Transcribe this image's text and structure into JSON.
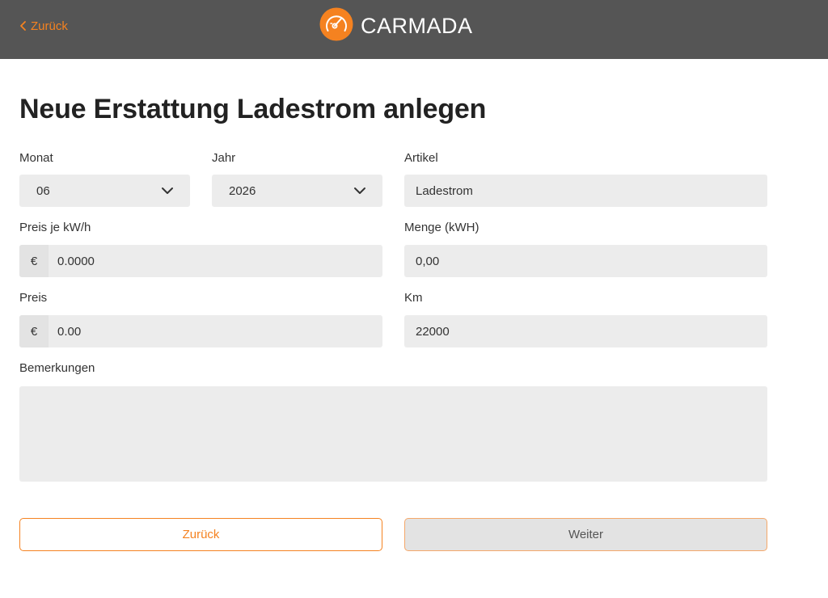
{
  "header": {
    "back_label": "Zurück",
    "brand": "CARMADA",
    "brand_color": "#f58220",
    "bar_color": "#555555"
  },
  "page": {
    "title": "Neue Erstattung Ladestrom anlegen"
  },
  "form": {
    "monat": {
      "label": "Monat",
      "value": "06"
    },
    "jahr": {
      "label": "Jahr",
      "value": "2026"
    },
    "artikel": {
      "label": "Artikel",
      "value": "Ladestrom"
    },
    "preis_kwh": {
      "label": "Preis je kW/h",
      "prefix": "€",
      "value": "0.0000"
    },
    "menge": {
      "label": "Menge (kWH)",
      "value": "0,00"
    },
    "preis": {
      "label": "Preis",
      "prefix": "€",
      "value": "0.00"
    },
    "km": {
      "label": "Km",
      "value": "22000"
    },
    "bemerkungen": {
      "label": "Bemerkungen",
      "value": ""
    }
  },
  "actions": {
    "back_label": "Zurück",
    "next_label": "Weiter"
  },
  "icons": {
    "back": "chevron-left-icon",
    "logo": "speedometer-icon",
    "dropdown": "chevron-down-icon"
  }
}
